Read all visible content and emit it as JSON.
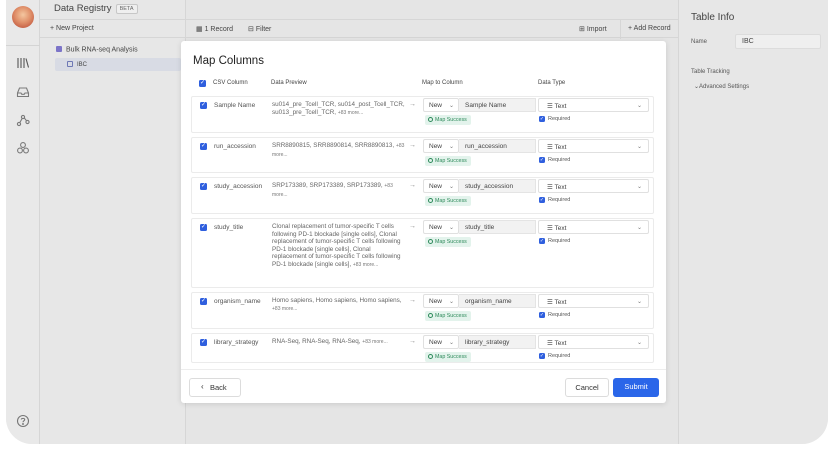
{
  "app": {
    "title": "Data Registry",
    "beta": "BETA"
  },
  "sidebar": {
    "new_project": "+ New Project",
    "project": "Bulk RNA-seq Analysis",
    "table": "IBC"
  },
  "toolbar": {
    "records": "1 Record",
    "filter": "Filter",
    "import": "Import",
    "add_record": "+ Add Record"
  },
  "right_panel": {
    "title": "Table Info",
    "name_label": "Name",
    "name_value": "IBC",
    "tracking": "Table Tracking",
    "advanced": "Advanced Settings"
  },
  "modal": {
    "title": "Map Columns",
    "headers": {
      "csv": "CSV Column",
      "preview": "Data Preview",
      "map": "Map to Column",
      "type": "Data Type"
    },
    "rows": [
      {
        "name": "Sample Name",
        "preview": "su014_pre_Tcell_TCR, su014_post_Tcell_TCR, su013_pre_Tcell_TCR,",
        "more": "+83 more...",
        "new_label": "New",
        "column": "Sample Name",
        "status": "Map Success",
        "type": "Text",
        "required": "Required"
      },
      {
        "name": "run_accession",
        "preview": "SRR8890815, SRR8890814, SRR8890813,",
        "more": "+83 more...",
        "new_label": "New",
        "column": "run_accession",
        "status": "Map Success",
        "type": "Text",
        "required": "Required"
      },
      {
        "name": "study_accession",
        "preview": "SRP173389, SRP173389, SRP173389,",
        "more": "+83 more...",
        "new_label": "New",
        "column": "study_accession",
        "status": "Map Success",
        "type": "Text",
        "required": "Required"
      },
      {
        "name": "study_title",
        "preview": "Clonal replacement of tumor-specific T cells following PD-1 blockade [single cells], Clonal replacement of tumor-specific T cells following PD-1 blockade [single cells], Clonal replacement of tumor-specific T cells following PD-1 blockade [single cells],",
        "more": "+83 more...",
        "new_label": "New",
        "column": "study_title",
        "status": "Map Success",
        "type": "Text",
        "required": "Required"
      },
      {
        "name": "organism_name",
        "preview": "Homo sapiens, Homo sapiens, Homo sapiens,",
        "more": "+83 more...",
        "new_label": "New",
        "column": "organism_name",
        "status": "Map Success",
        "type": "Text",
        "required": "Required"
      },
      {
        "name": "library_strategy",
        "preview": "RNA-Seq, RNA-Seq, RNA-Seq,",
        "more": "+83 more...",
        "new_label": "New",
        "column": "library_strategy",
        "status": "Map Success",
        "type": "Text",
        "required": "Required"
      }
    ],
    "back": "Back",
    "cancel": "Cancel",
    "submit": "Submit"
  }
}
